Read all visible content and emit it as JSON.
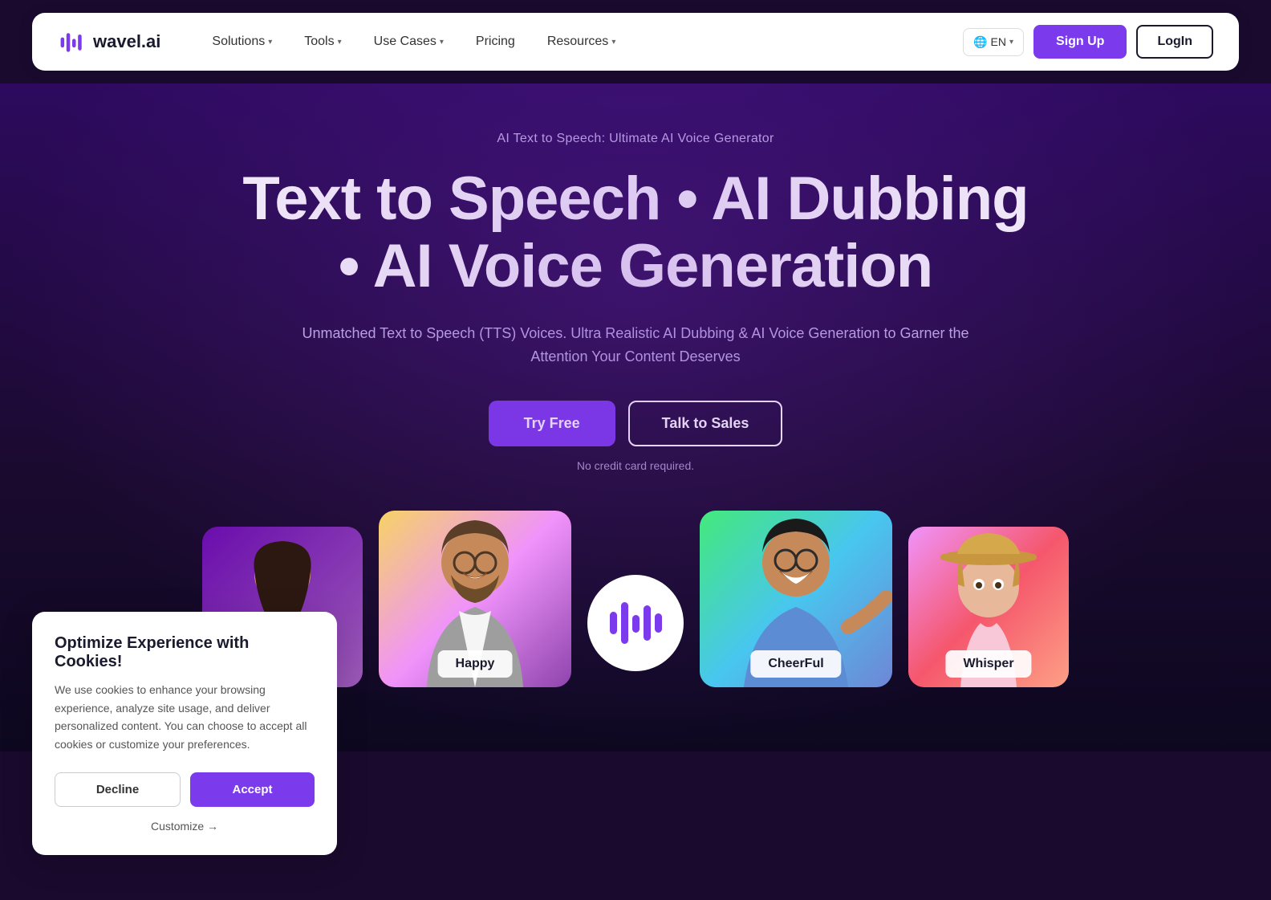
{
  "navbar": {
    "logo_text": "wavel.ai",
    "nav_items": [
      {
        "label": "Solutions",
        "has_dropdown": true
      },
      {
        "label": "Tools",
        "has_dropdown": true
      },
      {
        "label": "Use Cases",
        "has_dropdown": true
      },
      {
        "label": "Pricing",
        "has_dropdown": false
      },
      {
        "label": "Resources",
        "has_dropdown": true
      }
    ],
    "globe_label": "EN",
    "signup_label": "Sign Up",
    "login_label": "LogIn"
  },
  "hero": {
    "subtitle": "AI Text to Speech: Ultimate AI Voice Generator",
    "title_line1": "Text to Speech • AI Dubbing",
    "title_line2": "• AI Voice Generation",
    "description": "Unmatched Text to Speech (TTS) Voices. Ultra Realistic AI Dubbing & AI Voice Generation to Garner the Attention Your Content Deserves",
    "try_free_label": "Try Free",
    "talk_sales_label": "Talk to Sales",
    "no_credit_label": "No credit card required."
  },
  "voice_cards": [
    {
      "label": "",
      "id": "card-partial-left"
    },
    {
      "label": "Happy",
      "id": "card-happy"
    },
    {
      "label": "center-logo",
      "id": "card-center"
    },
    {
      "label": "CheerFul",
      "id": "card-cheerful"
    },
    {
      "label": "Whisper",
      "id": "card-whisper"
    }
  ],
  "cookie_banner": {
    "title": "Optimize Experience with Cookies!",
    "description": "We use cookies to enhance your browsing experience, analyze site usage, and deliver personalized content. You can choose to accept all cookies or customize your preferences.",
    "decline_label": "Decline",
    "accept_label": "Accept",
    "customize_label": "Customize →"
  }
}
